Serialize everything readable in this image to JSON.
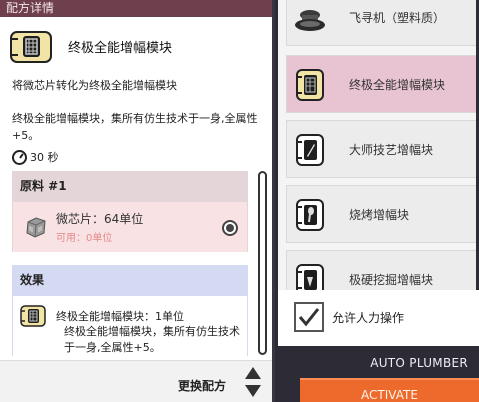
{
  "panel": {
    "header": "配方详情"
  },
  "recipe": {
    "title": "终极全能增幅模块",
    "description": "将微芯片转化为终极全能增幅模块",
    "detail": "终极全能增幅模块，集所有仿生技术于一身,全属性+5。",
    "time": "30 秒"
  },
  "ingredients": {
    "header": "原料 #1",
    "item_name": "微芯片：64单位",
    "available": "可用：0单位",
    "icon": "microchip-icon"
  },
  "effects": {
    "header": "效果",
    "line1": "终极全能增幅模块：1单位",
    "line2": "终极全能增幅模块，集所有仿生技术于一身,全属性+5。",
    "icon": "omni-module-icon"
  },
  "footer": {
    "change_recipe": "更换配方"
  },
  "recipe_list": [
    {
      "label": "飞寻机（塑料质）",
      "icon": "drone-icon",
      "selected": false
    },
    {
      "label": "终极全能增幅模块",
      "icon": "omni-module-icon",
      "selected": true
    },
    {
      "label": "大师技艺增幅块",
      "icon": "pen-module-icon",
      "selected": false
    },
    {
      "label": "烧烤增幅块",
      "icon": "spatula-module-icon",
      "selected": false
    },
    {
      "label": "极硬挖掘增幅块",
      "icon": "drill-module-icon",
      "selected": false
    }
  ],
  "controls": {
    "allow_manual": "允许人力操作",
    "allow_manual_checked": true,
    "auto_plumber": "AUTO PLUMBER",
    "activate": "ACTIVATE"
  },
  "colors": {
    "header_bg": "#6e3f4c",
    "selected_item": "#e8c4d2",
    "ingredient_bg": "#f8e2e4",
    "effect_header_bg": "#d4daf2",
    "activate": "#ee6a2c",
    "dark_bg": "#2d2b36"
  }
}
